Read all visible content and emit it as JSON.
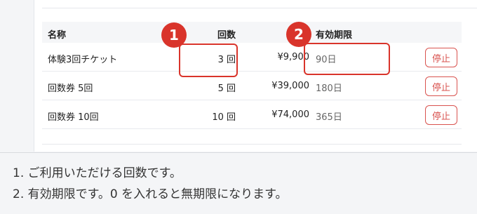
{
  "table": {
    "headers": {
      "name": "名称",
      "count": "回数",
      "expiry": "有効期限"
    },
    "rows": [
      {
        "name": "体験3回チケット",
        "count": "3 回",
        "price": "¥9,900",
        "expiry": "90日",
        "action": "停止"
      },
      {
        "name": "回数券 5回",
        "count": "5 回",
        "price": "¥39,000",
        "expiry": "180日",
        "action": "停止"
      },
      {
        "name": "回数券 10回",
        "count": "10 回",
        "price": "¥74,000",
        "expiry": "365日",
        "action": "停止"
      }
    ]
  },
  "callouts": {
    "one": "1",
    "two": "2"
  },
  "notes": {
    "line1": "1. ご利用いただける回数です。",
    "line2": "2. 有効期限です。0 を入れると無期限になります。"
  },
  "colors": {
    "accent": "#d9342b",
    "button": "#d9534f"
  }
}
